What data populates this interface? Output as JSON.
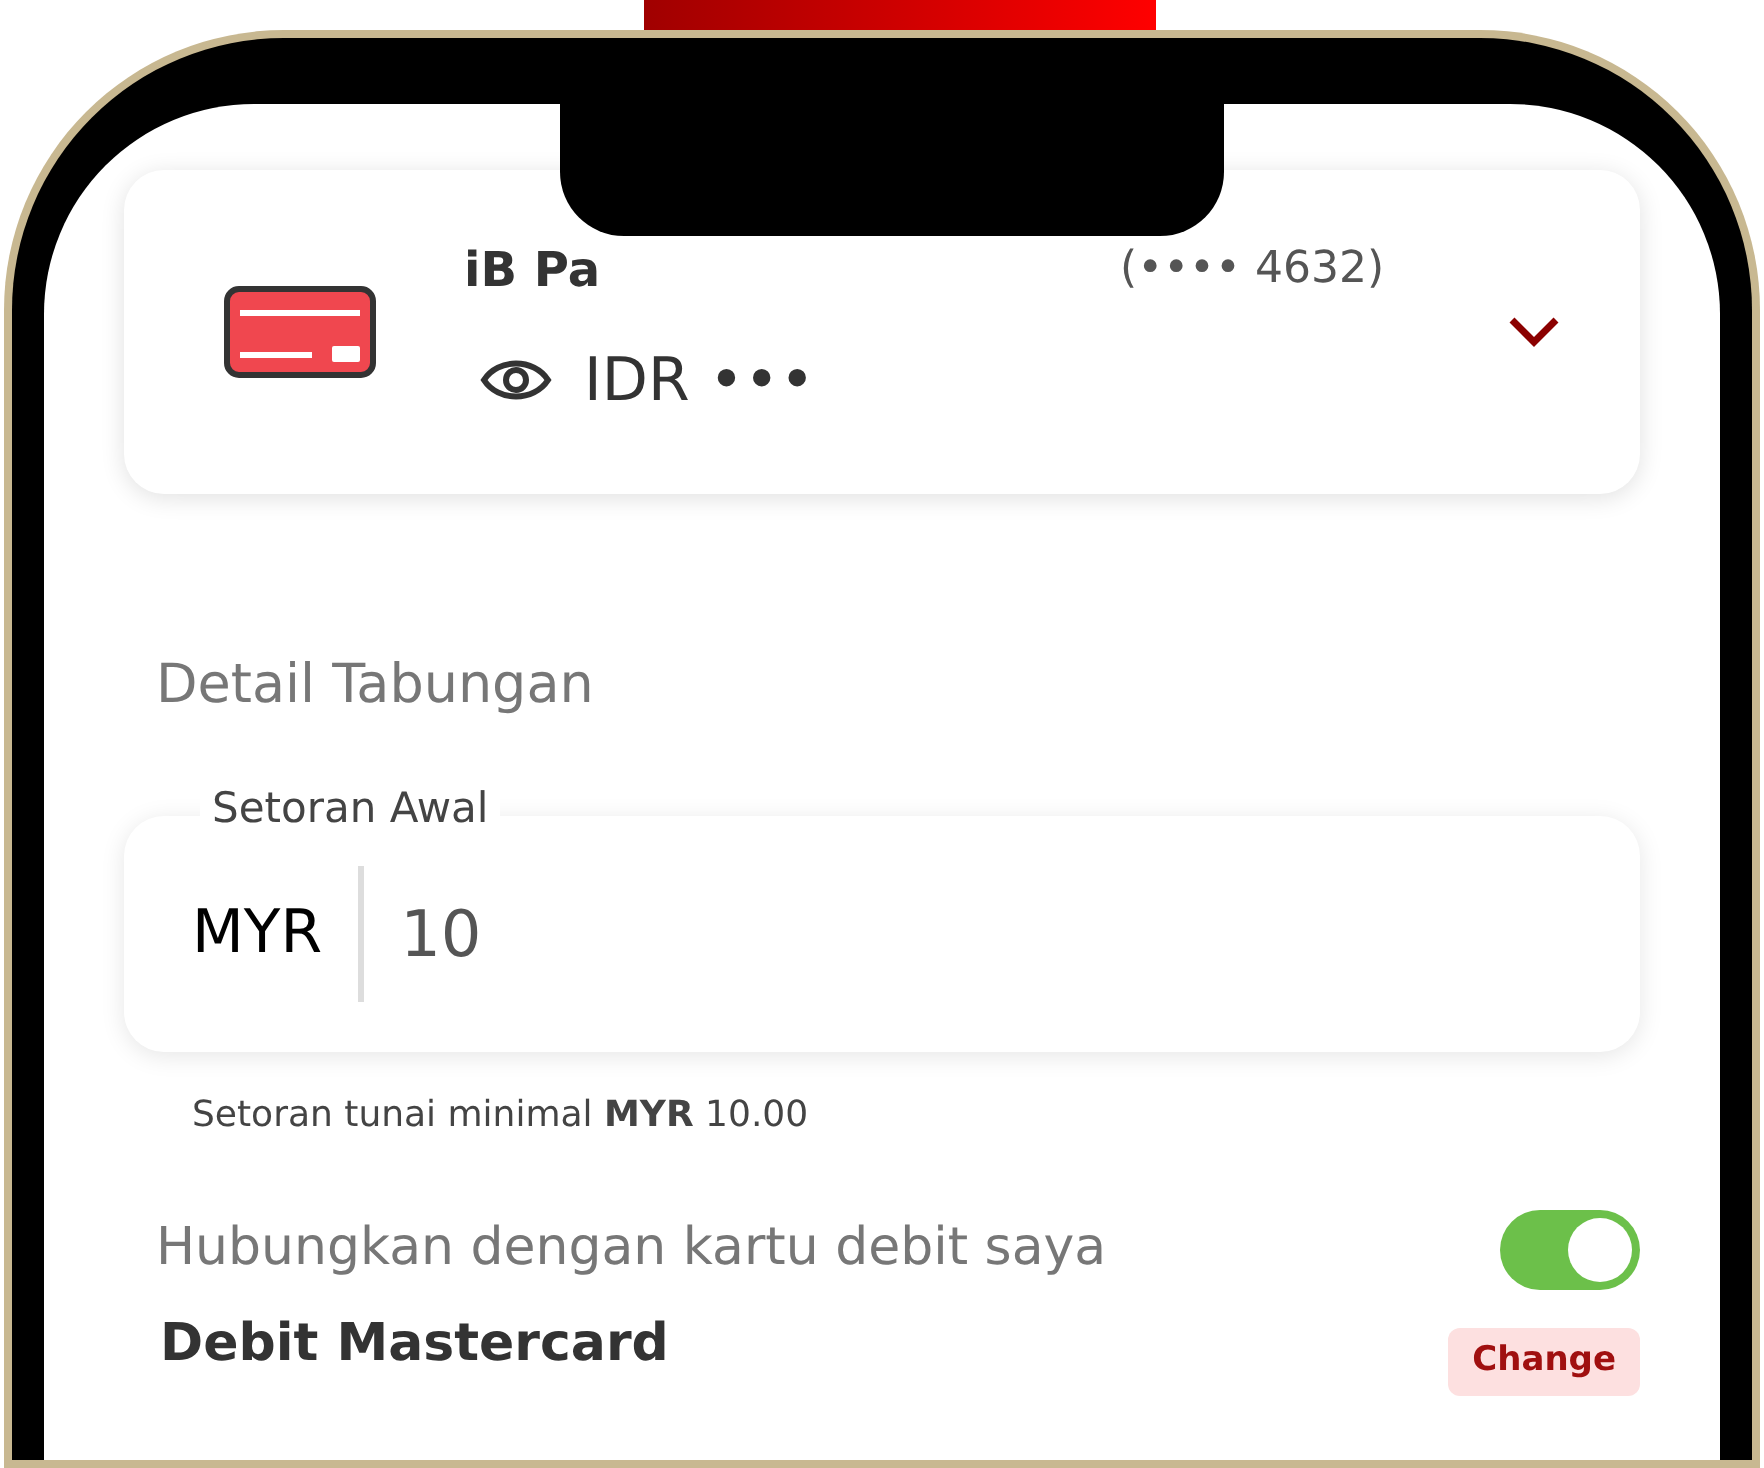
{
  "account": {
    "name": "iB Pa",
    "number": "(•••• 4632)",
    "balance": "IDR •••"
  },
  "section_title": "Detail Tabungan",
  "deposit": {
    "label": "Setoran Awal",
    "currency": "MYR",
    "value": "10",
    "hint": "Setoran tunai minimal **MYR** 10.00"
  },
  "link_debit": {
    "label": "Hubungkan dengan kartu debit saya",
    "on": true
  },
  "debit_card": {
    "name": "Debit Mastercard",
    "button": "Change"
  }
}
